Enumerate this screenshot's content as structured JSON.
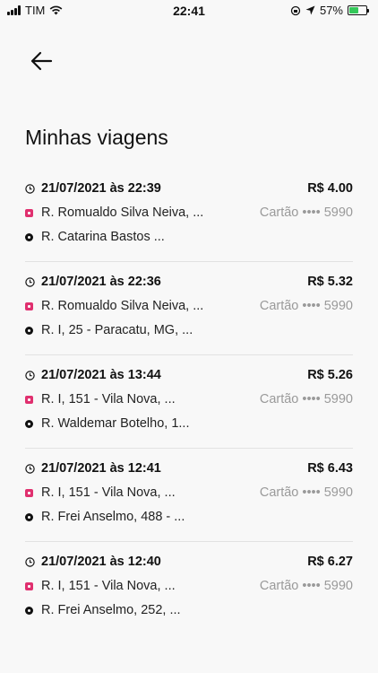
{
  "status_bar": {
    "carrier": "TIM",
    "time": "22:41",
    "battery": "57%",
    "battery_level": 0.57
  },
  "header": {
    "back_icon": "arrow-left-icon",
    "title": "Minhas viagens"
  },
  "colors": {
    "origin_marker": "#e0306f",
    "destination_marker": "#111111",
    "payment_text": "#9a9a9a"
  },
  "trips": [
    {
      "datetime": "21/07/2021 às 22:39",
      "price": "R$ 4.00",
      "origin": "R. Romualdo Silva Neiva, ...",
      "payment": "Cartão •••• 5990",
      "destination": "R. Catarina Bastos ..."
    },
    {
      "datetime": "21/07/2021 às 22:36",
      "price": "R$ 5.32",
      "origin": "R. Romualdo Silva Neiva, ...",
      "payment": "Cartão •••• 5990",
      "destination": "R. I, 25 - Paracatu, MG, ..."
    },
    {
      "datetime": "21/07/2021 às 13:44",
      "price": "R$ 5.26",
      "origin": "R. I, 151 - Vila Nova, ...",
      "payment": "Cartão •••• 5990",
      "destination": "R. Waldemar Botelho, 1..."
    },
    {
      "datetime": "21/07/2021 às 12:41",
      "price": "R$ 6.43",
      "origin": "R. I, 151 - Vila Nova, ...",
      "payment": "Cartão •••• 5990",
      "destination": "R. Frei Anselmo, 488 - ..."
    },
    {
      "datetime": "21/07/2021 às 12:40",
      "price": "R$ 6.27",
      "origin": "R. I, 151 - Vila Nova, ...",
      "payment": "Cartão •••• 5990",
      "destination": "R. Frei Anselmo, 252, ..."
    }
  ]
}
